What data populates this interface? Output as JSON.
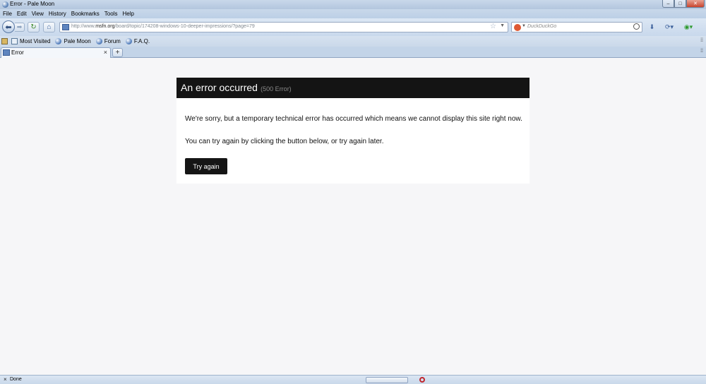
{
  "window": {
    "title": "Error - Pale Moon",
    "controls": {
      "minimize": "–",
      "maximize": "□",
      "close": "✕"
    }
  },
  "menu": [
    {
      "label": "File"
    },
    {
      "label": "Edit"
    },
    {
      "label": "View"
    },
    {
      "label": "History"
    },
    {
      "label": "Bookmarks"
    },
    {
      "label": "Tools"
    },
    {
      "label": "Help"
    }
  ],
  "nav": {
    "url_prefix": "http://www.",
    "url_domain": "msfn.org",
    "url_path": "/board/topic/174208-windows-10-deeper-impressions/?page=79",
    "search_placeholder": "DuckDuckGo"
  },
  "bookmarks": [
    {
      "label": "Most Visited"
    },
    {
      "label": "Pale Moon"
    },
    {
      "label": "Forum"
    },
    {
      "label": "F.A.Q."
    }
  ],
  "tab": {
    "label": "Error",
    "close": "×",
    "new": "+"
  },
  "page": {
    "error_title": "An error occurred",
    "error_code": "(500 Error)",
    "message1": "We're sorry, but a temporary technical error has occurred which means we cannot display this site right now.",
    "message2": "You can try again by clicking the button below, or try again later.",
    "button": "Try again"
  },
  "status": {
    "text": "Done",
    "x": "×"
  },
  "colors": {
    "header_bg": "#141414",
    "page_bg": "#f6f6f8",
    "button_bg": "#151515"
  }
}
